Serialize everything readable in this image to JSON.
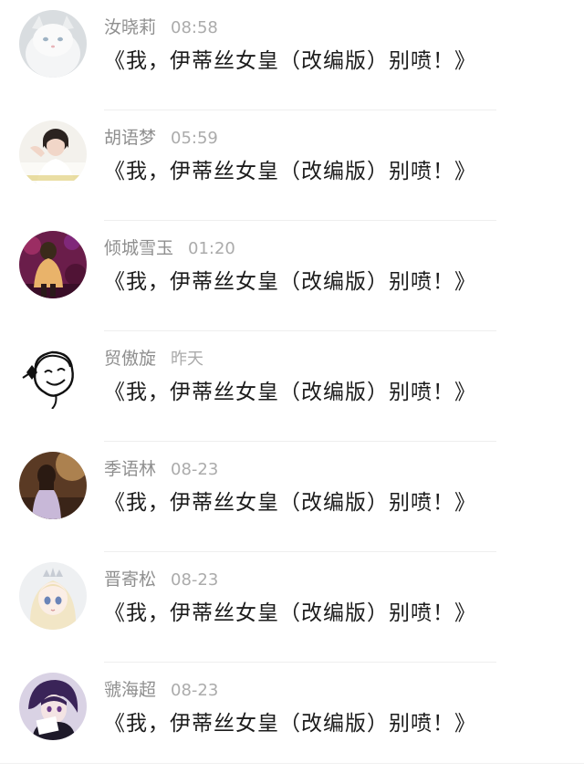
{
  "comments": [
    {
      "name": "汝晓莉",
      "time": "08:58",
      "text": "《我，伊蒂丝女皇（改编版）别喷！》",
      "avatar_icon": "white-cat-avatar-icon"
    },
    {
      "name": "胡语梦",
      "time": "05:59",
      "text": "《我，伊蒂丝女皇（改编版）别喷！》",
      "avatar_icon": "girl-photo-avatar-icon"
    },
    {
      "name": "倾城雪玉",
      "time": "01:20",
      "text": "《我，伊蒂丝女皇（改编版）别喷！》",
      "avatar_icon": "night-photo-avatar-icon"
    },
    {
      "name": "贸傲旋",
      "time": "昨天",
      "text": "《我，伊蒂丝女皇（改编版）别喷！》",
      "avatar_icon": "cartoon-face-avatar-icon"
    },
    {
      "name": "季语林",
      "time": "08-23",
      "text": "《我，伊蒂丝女皇（改编版）别喷！》",
      "avatar_icon": "sunset-girl-avatar-icon"
    },
    {
      "name": "晋寄松",
      "time": "08-23",
      "text": "《我，伊蒂丝女皇（改编版）别喷！》",
      "avatar_icon": "anime-princess-avatar-icon"
    },
    {
      "name": "虢海超",
      "time": "08-23",
      "text": "《我，伊蒂丝女皇（改编版）别喷！》",
      "avatar_icon": "anime-boy-avatar-icon"
    }
  ]
}
